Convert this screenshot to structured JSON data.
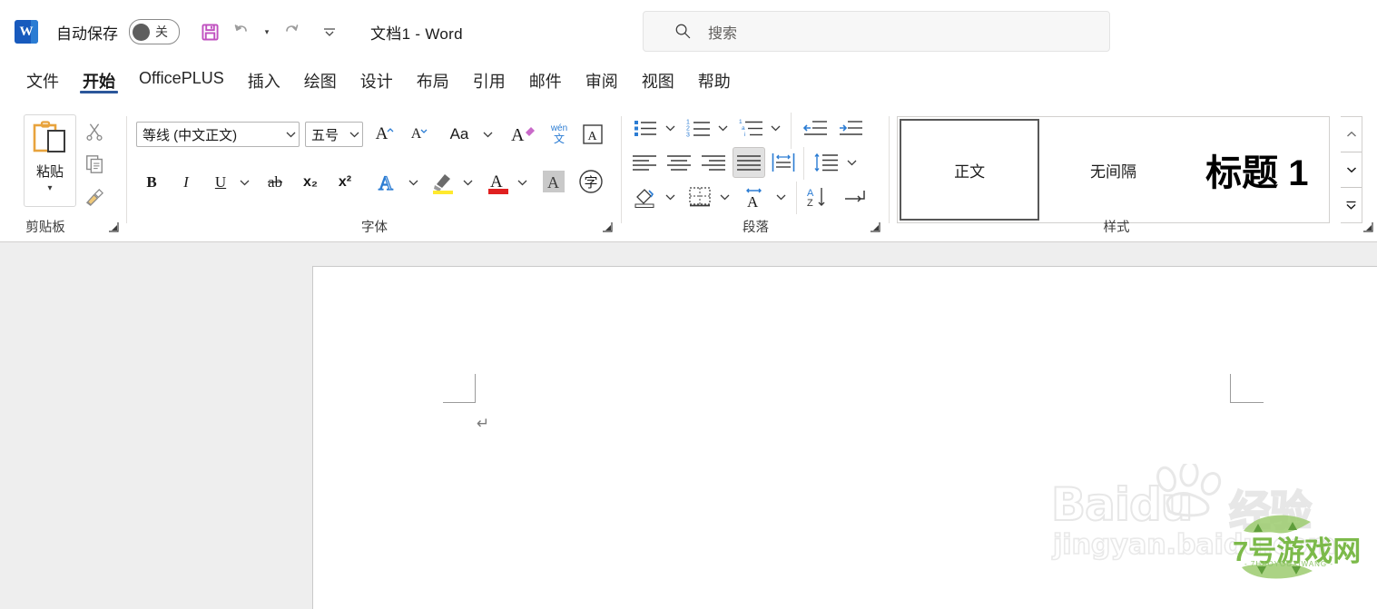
{
  "titlebar": {
    "app_logo_letter": "W",
    "autosave_label": "自动保存",
    "autosave_state": "关",
    "document_title": "文档1  -  Word",
    "quick_access": [
      {
        "name": "save",
        "tooltip": "保存"
      },
      {
        "name": "undo",
        "tooltip": "撤消"
      },
      {
        "name": "undo-dropdown",
        "tooltip": "撤消下拉"
      },
      {
        "name": "redo",
        "tooltip": "恢复"
      },
      {
        "name": "customize-qat",
        "tooltip": "自定义快速访问工具栏"
      }
    ]
  },
  "search": {
    "placeholder": "搜索",
    "icon": "search-icon"
  },
  "tabs": [
    {
      "label": "文件",
      "active": false
    },
    {
      "label": "开始",
      "active": true
    },
    {
      "label": "OfficePLUS",
      "active": false
    },
    {
      "label": "插入",
      "active": false
    },
    {
      "label": "绘图",
      "active": false
    },
    {
      "label": "设计",
      "active": false
    },
    {
      "label": "布局",
      "active": false
    },
    {
      "label": "引用",
      "active": false
    },
    {
      "label": "邮件",
      "active": false
    },
    {
      "label": "审阅",
      "active": false
    },
    {
      "label": "视图",
      "active": false
    },
    {
      "label": "帮助",
      "active": false
    }
  ],
  "ribbon": {
    "groups": [
      {
        "id": "clipboard",
        "label": "剪贴板",
        "paste_label": "粘贴",
        "buttons": [
          {
            "name": "cut-button",
            "icon": "scissors-icon"
          },
          {
            "name": "copy-button",
            "icon": "copy-icon"
          },
          {
            "name": "format-painter-button",
            "icon": "paintbrush-icon"
          }
        ]
      },
      {
        "id": "font",
        "label": "字体",
        "font_name": "等线 (中文正文)",
        "font_size": "五号",
        "buttons": [
          {
            "name": "grow-font-button",
            "icon": "increase-font-icon",
            "label": "A"
          },
          {
            "name": "shrink-font-button",
            "icon": "decrease-font-icon",
            "label": "A"
          },
          {
            "name": "change-case-button",
            "icon": "change-case-icon",
            "label": "Aa"
          },
          {
            "name": "clear-formatting-button",
            "icon": "clear-format-icon",
            "label": "A"
          },
          {
            "name": "phonetic-guide-button",
            "icon": "phonetic-icon",
            "label": "wén 文"
          },
          {
            "name": "character-border-button",
            "icon": "char-border-icon",
            "label": "A"
          },
          {
            "name": "bold-button",
            "icon": "bold-icon",
            "label": "B"
          },
          {
            "name": "italic-button",
            "icon": "italic-icon",
            "label": "I"
          },
          {
            "name": "underline-button",
            "icon": "underline-icon",
            "label": "U"
          },
          {
            "name": "strikethrough-button",
            "icon": "strikethrough-icon",
            "label": "ab"
          },
          {
            "name": "subscript-button",
            "icon": "subscript-icon",
            "label": "x₂"
          },
          {
            "name": "superscript-button",
            "icon": "superscript-icon",
            "label": "x²"
          },
          {
            "name": "text-effects-button",
            "icon": "text-effects-icon",
            "label": "A"
          },
          {
            "name": "highlight-color-button",
            "icon": "highlighter-icon"
          },
          {
            "name": "font-color-button",
            "icon": "font-color-icon",
            "label": "A"
          },
          {
            "name": "text-shading-button",
            "icon": "text-shading-icon",
            "label": "A"
          },
          {
            "name": "enclose-character-button",
            "icon": "enclose-char-icon",
            "label": "字"
          }
        ]
      },
      {
        "id": "paragraph",
        "label": "段落",
        "buttons": [
          {
            "name": "bullets-button",
            "icon": "bullet-list-icon"
          },
          {
            "name": "numbering-button",
            "icon": "numbered-list-icon"
          },
          {
            "name": "multilevel-list-button",
            "icon": "multilevel-list-icon"
          },
          {
            "name": "decrease-indent-button",
            "icon": "decrease-indent-icon"
          },
          {
            "name": "increase-indent-button",
            "icon": "increase-indent-icon"
          },
          {
            "name": "align-left-button",
            "icon": "align-left-icon"
          },
          {
            "name": "align-center-button",
            "icon": "align-center-icon"
          },
          {
            "name": "align-right-button",
            "icon": "align-right-icon"
          },
          {
            "name": "justify-button",
            "icon": "justify-icon",
            "selected": true
          },
          {
            "name": "distribute-button",
            "icon": "distribute-icon"
          },
          {
            "name": "line-spacing-button",
            "icon": "line-spacing-icon"
          },
          {
            "name": "shading-button",
            "icon": "shading-icon"
          },
          {
            "name": "borders-button",
            "icon": "borders-icon"
          },
          {
            "name": "asian-layout-button",
            "icon": "asian-layout-icon"
          },
          {
            "name": "sort-button",
            "icon": "sort-az-icon"
          },
          {
            "name": "show-formatting-marks-button",
            "icon": "pilcrow-icon"
          }
        ]
      },
      {
        "id": "styles",
        "label": "样式",
        "gallery": [
          {
            "name": "style-normal",
            "label": "正文",
            "selected": true
          },
          {
            "name": "style-no-spacing",
            "label": "无间隔",
            "selected": false
          },
          {
            "name": "style-heading1",
            "label": "标题 1",
            "selected": false
          }
        ],
        "scroll_buttons": [
          {
            "name": "styles-scroll-up",
            "glyph": "ⱏ"
          },
          {
            "name": "styles-scroll-down",
            "glyph": "ⱟ"
          },
          {
            "name": "styles-more",
            "glyph": "⌄"
          }
        ]
      }
    ]
  },
  "document": {
    "paragraph_mark": "↵",
    "page_name": "文档页面"
  },
  "watermark": {
    "brand": "Baidu",
    "brand_cn": "经验",
    "site": "jingyan.baidu.com",
    "overlay_text": "7号游戏网",
    "overlay_sub": "- 7HAOYOUXIWANG -"
  },
  "colors": {
    "accent": "#2b579a",
    "word_blue": "#185abd",
    "ribbon_bg": "#ffffff",
    "canvas_bg": "#eeeeee",
    "page_bg": "#ffffff",
    "icon_blue": "#2b7cd3",
    "watermark_green": "#7cba4a"
  }
}
